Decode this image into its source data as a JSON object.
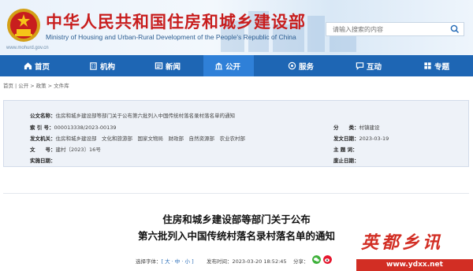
{
  "header": {
    "title": "中华人民共和国住房和城乡建设部",
    "subtitle": "Ministry of Housing and Urban-Rural Development of the People's Republic of China",
    "url": "www.mohurd.gov.cn",
    "search_placeholder": "请输入搜索的内容"
  },
  "nav": {
    "items": [
      {
        "label": "首页",
        "icon": "home-icon"
      },
      {
        "label": "机构",
        "icon": "building-icon"
      },
      {
        "label": "新闻",
        "icon": "news-icon"
      },
      {
        "label": "公开",
        "icon": "open-icon"
      },
      {
        "label": "服务",
        "icon": "service-icon"
      },
      {
        "label": "互动",
        "icon": "chat-icon"
      },
      {
        "label": "专题",
        "icon": "topic-icon"
      }
    ],
    "active": "公开"
  },
  "breadcrumb": [
    "首页",
    "公开",
    "政策",
    "文件库"
  ],
  "info": {
    "public_title_label": "公文名称：",
    "public_title_value": "住房和城乡建设部等部门关于公布第六批列入中国传统村落名录村落名单的通知",
    "index_label": "索 引 号：",
    "index_value": "000013338/2023-00139",
    "category_label": "分　　类：",
    "category_value": "村镇建设",
    "issuer_label": "发文机关：",
    "issuer_value": "住房和城乡建设部　文化和旅游部　国家文物局　财政部　自然资源部　农业农村部",
    "issue_date_label": "发文日期：",
    "issue_date_value": "2023-03-19",
    "doc_no_label": "文　　号：",
    "doc_no_value": "建村〔2023〕16号",
    "subject_label": "主 题 词：",
    "subject_value": "",
    "effective_label": "实施日期：",
    "effective_value": "",
    "expiry_label": "废止日期：",
    "expiry_value": ""
  },
  "article": {
    "title_line1": "住房和城乡建设部等部门关于公布",
    "title_line2": "第六批列入中国传统村落名录村落名单的通知",
    "font_size_label": "选择字体：",
    "font_size_options": "[ 大 · 中 · 小 ]",
    "time_label": "发布时间：",
    "time_value": "2023-03-20 18:52:45",
    "share_label": "分享："
  },
  "watermark": {
    "text": "英都乡讯",
    "url": "www.ydxx.net"
  },
  "colors": {
    "brand_red": "#c81e1e",
    "nav_blue": "#1e66b4",
    "nav_active": "#2f80d8",
    "info_bg": "#eef2f8"
  }
}
